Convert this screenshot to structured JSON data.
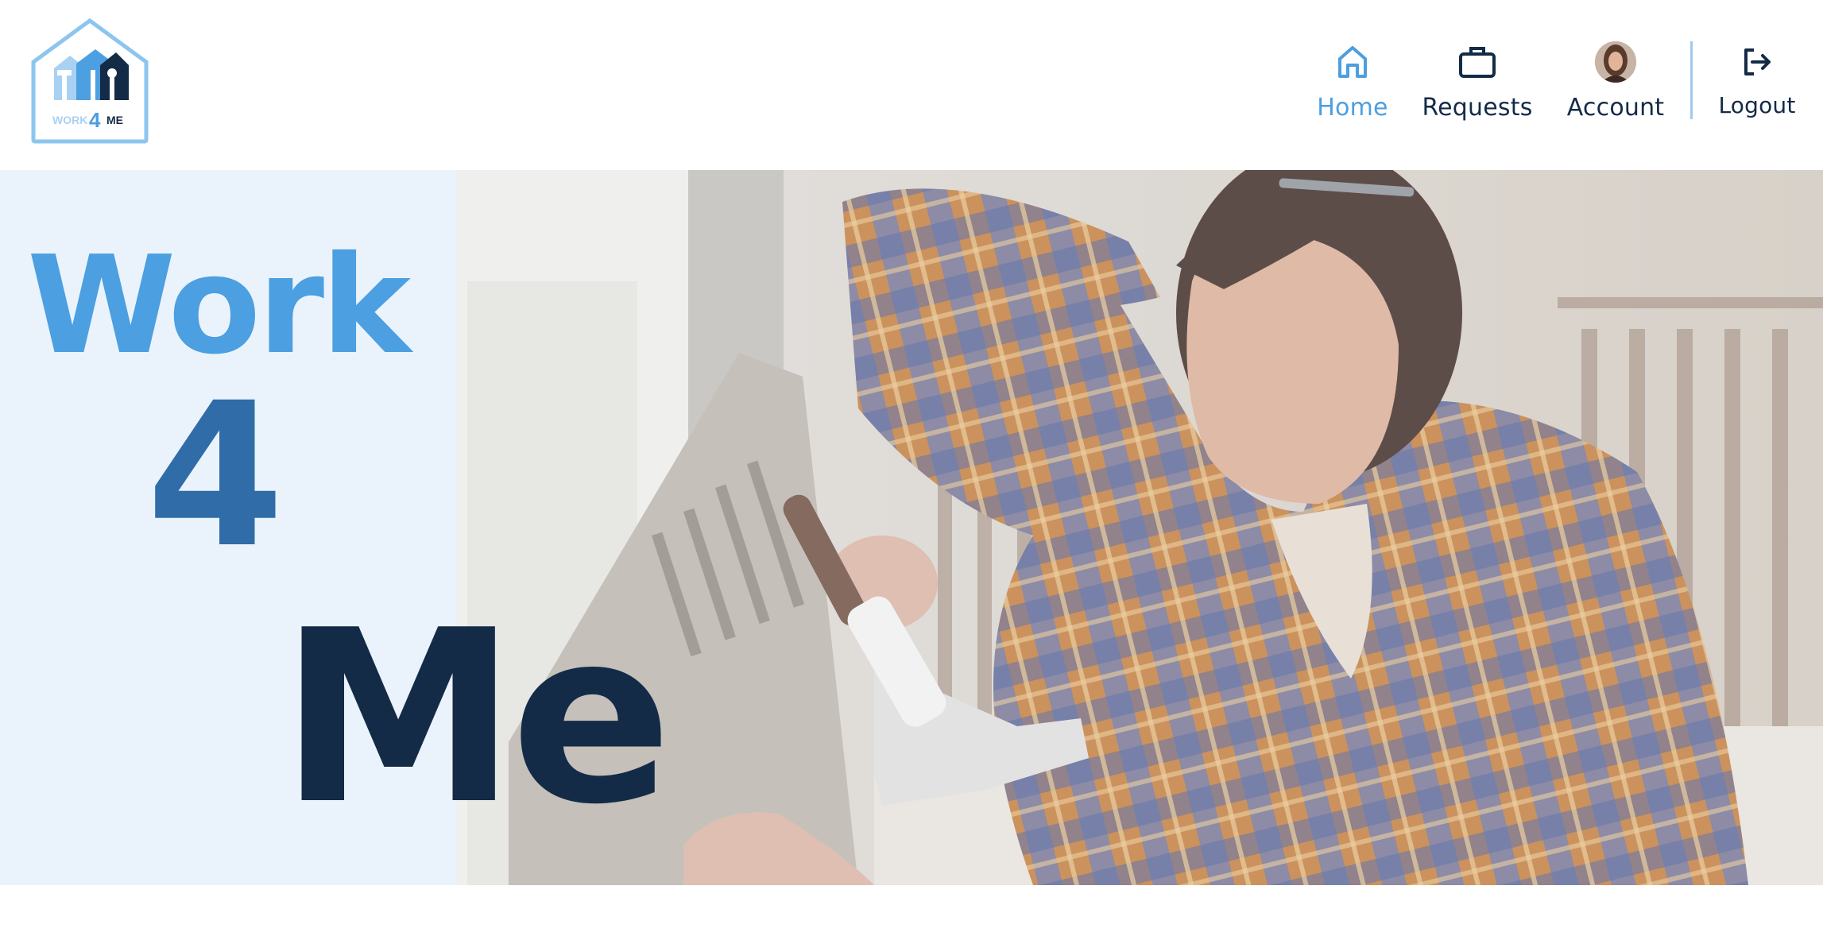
{
  "app": {
    "brand_logo_text": "WORK 4 ME"
  },
  "nav": {
    "home_label": "Home",
    "requests_label": "Requests",
    "account_label": "Account",
    "logout_label": "Logout",
    "active": "home"
  },
  "hero": {
    "line1": "Work",
    "line2": "4",
    "line3": "Me"
  },
  "icons": {
    "home": "home-icon",
    "requests": "briefcase-icon",
    "account": "avatar",
    "logout": "logout-icon"
  },
  "colors": {
    "accent": "#4c9fe0",
    "mid_blue": "#2f6ca8",
    "navy": "#142b47",
    "panel": "#eaf3fc"
  }
}
